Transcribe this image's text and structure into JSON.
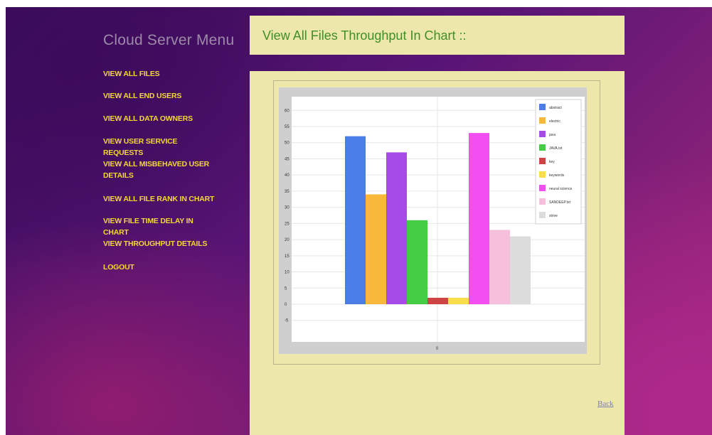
{
  "menu": {
    "title": "Cloud Server Menu",
    "items": [
      "VIEW ALL FILES",
      "VIEW ALL END USERS",
      "VIEW ALL DATA OWNERS",
      "VIEW USER SERVICE REQUESTS",
      "VIEW ALL MISBEHAVED USER DETAILS",
      "VIEW ALL FILE RANK IN CHART",
      "VIEW FILE TIME DELAY IN CHART",
      "VIEW THROUGHPUT DETAILS",
      "LOGOUT"
    ]
  },
  "header": {
    "title": "View All Files Throughput In Chart ::"
  },
  "back_label": "Back",
  "chart_data": {
    "type": "bar",
    "x_tick_label": "0",
    "ylim": [
      -10,
      65
    ],
    "y_ticks": [
      -5,
      0,
      5,
      10,
      15,
      20,
      25,
      30,
      35,
      40,
      45,
      50,
      55,
      60
    ],
    "grid": true,
    "legend_position": "top-right",
    "series": [
      {
        "name": "abstract",
        "value": 52,
        "color": "#4a7ee6"
      },
      {
        "name": "electric",
        "value": 34,
        "color": "#f7b83c"
      },
      {
        "name": "java",
        "value": 47,
        "color": "#a64be8"
      },
      {
        "name": "JAVA.txt",
        "value": 26,
        "color": "#44cc44"
      },
      {
        "name": "key",
        "value": 2,
        "color": "#cc4444"
      },
      {
        "name": "keywords",
        "value": 2,
        "color": "#f9de4b"
      },
      {
        "name": "neural science",
        "value": 53,
        "color": "#f24ef2"
      },
      {
        "name": "SANDEEP.txt",
        "value": 23,
        "color": "#f6c0dc"
      },
      {
        "name": "strive",
        "value": 21,
        "color": "#dcdcdc"
      }
    ]
  }
}
